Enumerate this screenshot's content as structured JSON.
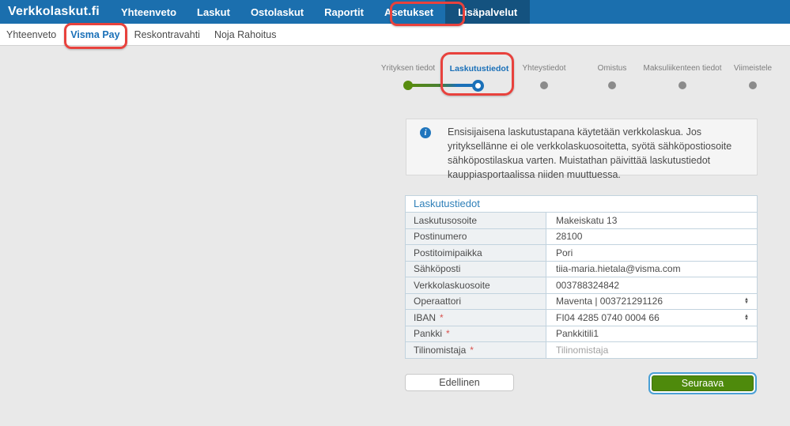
{
  "topnav": {
    "brand": "Verkkolaskut.fi",
    "items": [
      "Yhteenveto",
      "Laskut",
      "Ostolaskut",
      "Raportit",
      "Asetukset",
      "Lisäpalvelut"
    ]
  },
  "subnav": {
    "items": [
      "Yhteenveto",
      "Visma Pay",
      "Reskontravahti",
      "Noja Rahoitus"
    ]
  },
  "stepper": {
    "steps": [
      {
        "label": "Yrityksen tiedot",
        "state": "done"
      },
      {
        "label": "Laskutustiedot",
        "state": "active"
      },
      {
        "label": "Yhteystiedot",
        "state": "todo"
      },
      {
        "label": "Omistus",
        "state": "todo"
      },
      {
        "label": "Maksuliikenteen tiedot",
        "state": "todo"
      },
      {
        "label": "Viimeistele",
        "state": "todo"
      }
    ]
  },
  "info": {
    "text": "Ensisijaisena laskutustapana käytetään verkkolaskua. Jos yrityksellänne ei ole verkkolaskuosoitetta, syötä sähköpostiosoite sähköpostilaskua varten. Muistathan päivittää laskutustiedot kauppiasportaalissa niiden muuttuessa.",
    "icon": "info-icon",
    "icon_glyph": "i"
  },
  "form": {
    "title": "Laskutustiedot",
    "required_marker": "*",
    "rows": [
      {
        "label": "Laskutusosoite",
        "value": "Makeiskatu 13"
      },
      {
        "label": "Postinumero",
        "value": "28100"
      },
      {
        "label": "Postitoimipaikka",
        "value": "Pori"
      },
      {
        "label": "Sähköposti",
        "value": "tiia-maria.hietala@visma.com"
      },
      {
        "label": "Verkkolaskuosoite",
        "value": "003788324842"
      },
      {
        "label": "Operaattori",
        "value": "Maventa | 003721291126",
        "control": "select"
      },
      {
        "label": "IBAN",
        "value": "FI04 4285 0740 0004 66",
        "control": "select",
        "required": true
      },
      {
        "label": "Pankki",
        "value": "Pankkitili1",
        "required": true
      },
      {
        "label": "Tilinomistaja",
        "value": "",
        "placeholder": "Tilinomistaja",
        "required": true
      }
    ]
  },
  "buttons": {
    "previous": "Edellinen",
    "next": "Seuraava"
  },
  "icons": {
    "select_up": "▲",
    "select_down": "▼"
  },
  "colors": {
    "topbar_blue": "#1b6fae",
    "active_item_blue": "#14527f",
    "accent_blue": "#1a70b8",
    "annotation_red": "#e8423d",
    "done_green": "#578c0e",
    "todo_gray": "#8b8b8b",
    "next_button_green": "#4e8a0c",
    "focus_ring_blue": "#4aa0d5",
    "required_red": "#d9534f"
  }
}
